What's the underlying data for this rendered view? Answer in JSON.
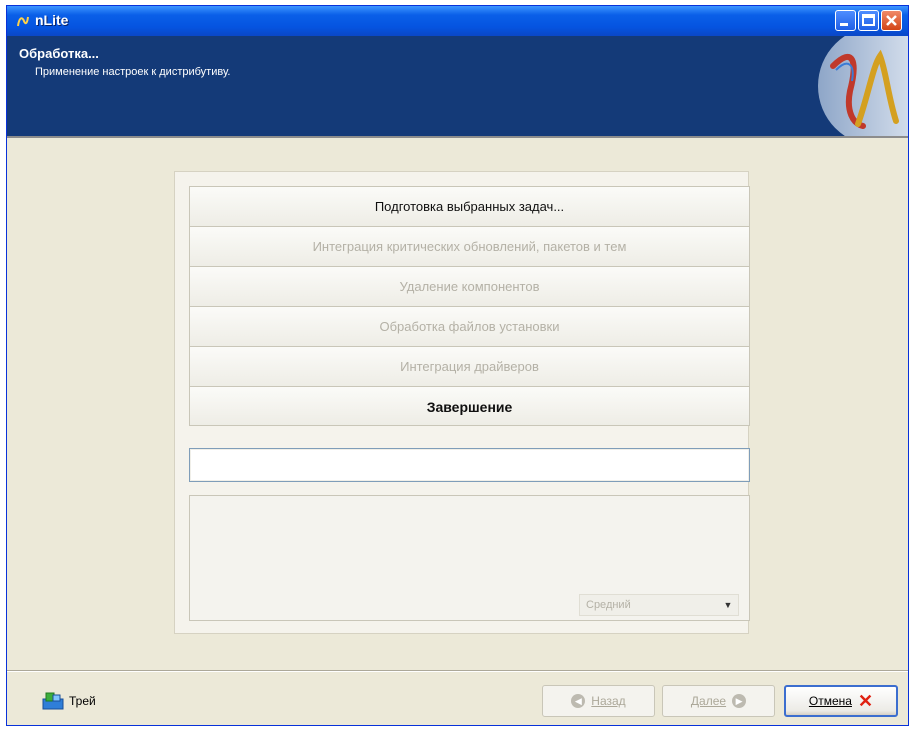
{
  "window": {
    "title": "nLite"
  },
  "header": {
    "title": "Обработка...",
    "subtitle": "Применение настроек к дистрибутиву."
  },
  "tasks": [
    {
      "label": "Подготовка выбранных задач...",
      "state": "active"
    },
    {
      "label": "Интеграция критических обновлений, пакетов и тем",
      "state": "pending"
    },
    {
      "label": "Удаление компонентов",
      "state": "pending"
    },
    {
      "label": "Обработка файлов установки",
      "state": "pending"
    },
    {
      "label": "Интеграция драйверов",
      "state": "pending"
    },
    {
      "label": "Завершение",
      "state": "bold"
    }
  ],
  "priority": {
    "selected": "Средний"
  },
  "footer": {
    "tray_label": "Трей",
    "back_label": "Назад",
    "next_label": "Далее",
    "cancel_label": "Отмена"
  },
  "colors": {
    "titlebar": "#0554e0",
    "header": "#143a78",
    "face": "#ece9d8",
    "cancel": "#e02010"
  }
}
